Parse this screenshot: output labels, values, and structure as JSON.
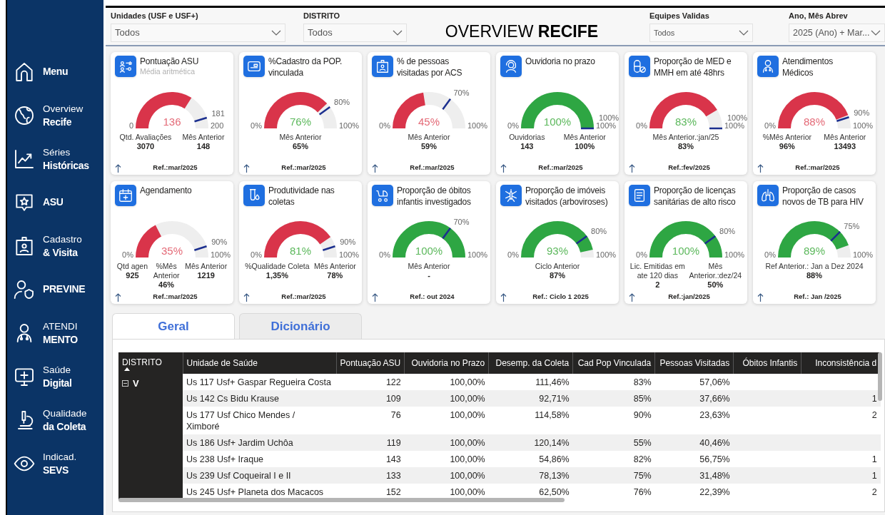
{
  "sidebar": {
    "items": [
      {
        "label": "Menu"
      },
      {
        "caption": "Overview",
        "label": "Recife"
      },
      {
        "caption": "Séries",
        "label": "Históricas"
      },
      {
        "label": "ASU"
      },
      {
        "caption": "Cadastro",
        "label": "& Visita"
      },
      {
        "label": "PREVINE"
      },
      {
        "caption": "ATENDI",
        "label": "MENTO"
      },
      {
        "caption": "Saúde",
        "label": "Digital"
      },
      {
        "caption": "Qualidade",
        "label": "da Coleta"
      },
      {
        "caption": "Indicad.",
        "label": "SEVS"
      }
    ]
  },
  "filters": [
    {
      "label": "Unidades (USF e USF+)",
      "value": "Todos"
    },
    {
      "label": "DISTRITO",
      "value": "Todos"
    },
    {
      "label": "Equipes Validas",
      "value": "Todos"
    },
    {
      "label": "Ano, Mês Abrev",
      "value": "2025 (Ano) + Mar..."
    }
  ],
  "title": "OVERVIEW **RECIFE**",
  "cards": [
    {
      "title": "Pontuação ASU",
      "subtitle": "Média aritmética",
      "gauge": {
        "color": "#d9344a",
        "value": {
          "text": "136",
          "color": "#e46a77"
        },
        "min": "0",
        "max": "200",
        "target": {
          "label": "181"
        }
      },
      "stats": [
        {
          "label": "Qtd. Avaliações",
          "value": "3070"
        },
        {
          "label": "Mês Anterior",
          "value": "148"
        }
      ],
      "ref": "Ref.:mar/2025"
    },
    {
      "title": "%Cadastro da POP.\nvinculada",
      "gauge": {
        "color": "#d9344a",
        "value": {
          "text": "76%",
          "color": "#5cb85c"
        },
        "min": "0%",
        "max": "100%",
        "target": {
          "label": "80%"
        }
      },
      "stats": [
        {
          "label": "Mês Anterior",
          "value": "65%"
        }
      ],
      "ref": "Ref.:mar/2025"
    },
    {
      "title": "% de pessoas\nvisitadas por ACS",
      "gauge": {
        "color": "#d9344a",
        "value": {
          "text": "45%",
          "color": "#e46a77"
        },
        "min": "0%",
        "max": "100%",
        "target": {
          "label": "70%"
        }
      },
      "stats": [
        {
          "label": "Mês Anterior",
          "value": "59%"
        }
      ],
      "ref": "Ref.:mar/2025"
    },
    {
      "title": "Ouvidoria no prazo",
      "gauge": {
        "color": "#2ea643",
        "value": {
          "text": "100%",
          "color": "#5cb85c"
        },
        "min": "0%",
        "max": "100%",
        "target": {
          "label": "100%"
        }
      },
      "stats": [
        {
          "label": "Ouvidorias",
          "value": "143"
        },
        {
          "label": "Mês Anterior",
          "value": "100%"
        }
      ],
      "ref": "Ref.:mar/2025"
    },
    {
      "title": "Proporção de MED e\nMMH em até 48hrs",
      "gauge": {
        "color": "#d9344a",
        "value": {
          "text": "83%",
          "color": "#5cb85c"
        },
        "min": "0%",
        "max": "100%",
        "target": {
          "label": "100%"
        }
      },
      "stats": [
        {
          "label": "Mês Anterior.:jan/25",
          "value": "83%"
        }
      ],
      "ref": "Ref.:fev/2025"
    },
    {
      "title": "Atendimentos\nMédicos",
      "gauge": {
        "color": "#d9344a",
        "value": {
          "text": "88%",
          "color": "#e46a77"
        },
        "min": "0%",
        "max": "100%",
        "target": {
          "label": "90%"
        }
      },
      "stats": [
        {
          "label": "%Mês Anterior",
          "value": "96%"
        },
        {
          "label": "Mês Anterior",
          "value": "13493"
        }
      ],
      "ref": "Ref.:mar/2025"
    },
    {
      "title": "Agendamento",
      "gauge": {
        "color": "#d9344a",
        "value": {
          "text": "35%",
          "color": "#e46a77"
        },
        "min": "0%",
        "max": "100%",
        "target": {
          "label": "90%"
        }
      },
      "stats": [
        {
          "label": "Qtd agen",
          "value": "925"
        },
        {
          "label": "%Mês\nAnterior",
          "value": "46%"
        },
        {
          "label": "Mês Anterior",
          "value": "1219"
        }
      ],
      "ref": "Ref.:mar/2025"
    },
    {
      "title": "Produtividade nas\ncoletas",
      "gauge": {
        "color": "#d9344a",
        "value": {
          "text": "81%",
          "color": "#5cb85c"
        },
        "min": "0%",
        "max": "100%",
        "target": {
          "label": "90%"
        }
      },
      "stats": [
        {
          "label": "%Qualidade Coleta",
          "value": "1,35%"
        },
        {
          "label": "Mês Anterior",
          "value": "78%"
        }
      ],
      "ref": "Ref.:mar/2025"
    },
    {
      "title": "Proporção de óbitos\ninfantis investigados",
      "gauge": {
        "color": "#2ea643",
        "value": {
          "text": "100%",
          "color": "#5cb85c"
        },
        "min": "0%",
        "max": "100%",
        "target": {
          "label": "70%"
        }
      },
      "stats": [
        {
          "label": "Mês Anterior",
          "value": "-"
        }
      ],
      "ref": "Ref.: out 2024"
    },
    {
      "title": "Proporção de imóveis\nvisitados (arboviroses)",
      "gauge": {
        "color": "#2ea643",
        "value": {
          "text": "93%",
          "color": "#5cb85c"
        },
        "min": "0%",
        "max": "100%",
        "target": {
          "label": "80%"
        }
      },
      "stats": [
        {
          "label": "Ciclo Anterior",
          "value": "87%"
        }
      ],
      "ref": "Ref.: Ciclo 1 2025"
    },
    {
      "title": "Proporção de licenças\nsanitárias de alto risco",
      "gauge": {
        "color": "#2ea643",
        "value": {
          "text": "100%",
          "color": "#5cb85c"
        },
        "min": "0%",
        "max": "100%",
        "target": {
          "label": "80%"
        }
      },
      "stats": [
        {
          "label": "Lic. Emitidas em\nate 120 dias",
          "value": "2"
        },
        {
          "label": "Mês\nAnterior.:dez/24",
          "value": "50%"
        }
      ],
      "ref": "Ref.:jan/2025"
    },
    {
      "title": "Proporção de casos\nnovos de TB para HIV",
      "gauge": {
        "color": "#2ea643",
        "value": {
          "text": "89%",
          "color": "#5cb85c"
        },
        "min": "0%",
        "max": "100%",
        "target": {
          "label": "75%"
        }
      },
      "stats": [
        {
          "label": "Ref Anterior.: Jan a Dez 2024",
          "value": "88%"
        }
      ],
      "ref": "Ref.: Jan /2025"
    }
  ],
  "tabs": [
    {
      "label": "Geral",
      "selected": true
    },
    {
      "label": "Dicionário",
      "selected": false
    }
  ],
  "table": {
    "columns": [
      {
        "label": "DISTRITO",
        "sorted": true
      },
      {
        "label": "Unidade de Saúde",
        "sorted": false
      },
      {
        "label": "Pontuação ASU",
        "sorted": false
      },
      {
        "label": "Ouvidoria no Prazo",
        "sorted": false
      },
      {
        "label": "Desemp. da Coleta",
        "sorted": false
      },
      {
        "label": "Cad Pop Vinculada",
        "sorted": false
      },
      {
        "label": "Pessoas Visitadas",
        "sorted": false
      },
      {
        "label": "Óbitos Infantis",
        "sorted": false
      },
      {
        "label": "Inconsistência d",
        "sorted": false
      }
    ],
    "groups": [
      {
        "label": "V",
        "expanded": true,
        "rows": [
          {
            "unidade": "Us 117 Usf+ Gaspar Regueira Costa",
            "pontuacao_asu": "122",
            "ouvidoria": "100,00%",
            "coleta": "111,46%",
            "cad_pop": "83%",
            "visitadas": "57,06%"
          },
          {
            "unidade": "Us 142 Cs Bidu Krause",
            "pontuacao_asu": "109",
            "ouvidoria": "100,00%",
            "coleta": "92,71%",
            "cad_pop": "85%",
            "visitadas": "37,66%",
            "column_9": "1"
          },
          {
            "unidade": "Us 177 Usf Chico Mendes /\nXimboré",
            "pontuacao_asu": "76",
            "ouvidoria": "100,00%",
            "coleta": "114,58%",
            "cad_pop": "90%",
            "visitadas": "23,63%",
            "column_9": "2"
          },
          {
            "unidade": "Us 186 Usf+ Jardim Uchôa",
            "pontuacao_asu": "119",
            "ouvidoria": "100,00%",
            "coleta": "120,14%",
            "cad_pop": "55%",
            "visitadas": "40,46%"
          },
          {
            "unidade": "Us 238 Usf+ Iraque",
            "pontuacao_asu": "143",
            "ouvidoria": "100,00%",
            "coleta": "54,86%",
            "cad_pop": "82%",
            "visitadas": "56,75%",
            "column_9": "1"
          },
          {
            "unidade": "Us 239 Usf Coqueiral I e II",
            "pontuacao_asu": "133",
            "ouvidoria": "100,00%",
            "coleta": "78,13%",
            "cad_pop": "75%",
            "visitadas": "31,48%",
            "column_9": "1"
          },
          {
            "unidade": "Us 245 Usf+ Planeta dos Macacos",
            "pontuacao_asu": "152",
            "ouvidoria": "100,00%",
            "coleta": "62,50%",
            "cad_pop": "76%",
            "visitadas": "22,39%",
            "column_9": "2"
          }
        ]
      }
    ]
  }
}
